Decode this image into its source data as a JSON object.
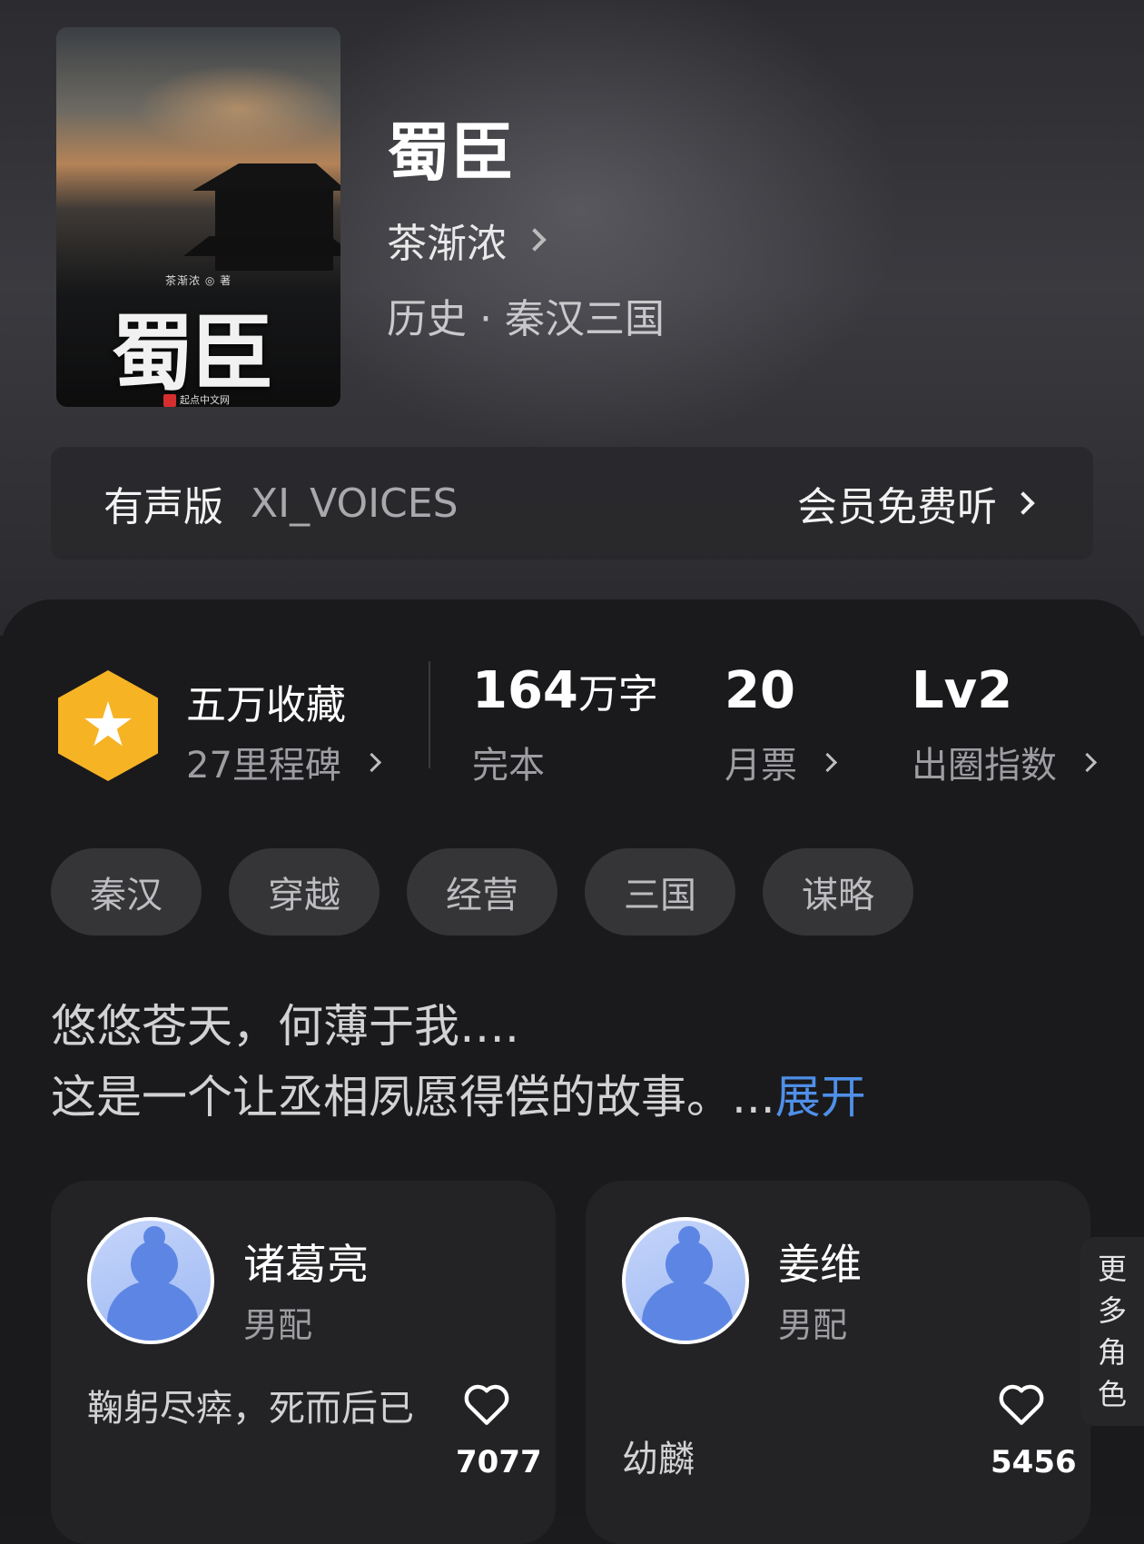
{
  "book": {
    "cover_title": "蜀臣",
    "cover_author": "茶渐浓 ◎ 著",
    "cover_publisher": "起点中文网",
    "title": "蜀臣",
    "author": "茶渐浓",
    "category": "历史 · 秦汉三国"
  },
  "audio": {
    "label": "有声版",
    "voice": "XI_VOICES",
    "cta": "会员免费听"
  },
  "stats": {
    "collection_main": "五万收藏",
    "collection_sub": "27里程碑",
    "words_num": "164",
    "words_unit": "万字",
    "words_sub": "完本",
    "monthly_votes": "20",
    "monthly_votes_sub": "月票",
    "level": "Lv2",
    "level_sub": "出圈指数"
  },
  "tags": [
    "秦汉",
    "穿越",
    "经营",
    "三国",
    "谋略"
  ],
  "synopsis": {
    "line1": "悠悠苍天，何薄于我….",
    "line2": "这是一个让丞相夙愿得偿的故事。...",
    "expand": "展开"
  },
  "characters": [
    {
      "name": "诸葛亮",
      "role": "男配",
      "quote": "鞠躬尽瘁，死而后已",
      "likes": "7077"
    },
    {
      "name": "姜维",
      "role": "男配",
      "quote": "幼麟",
      "likes": "5456"
    }
  ],
  "more_roles": [
    "更",
    "多",
    "角",
    "色"
  ],
  "colors": {
    "accent": "#4f8fe8",
    "badge": "#f6b324",
    "background": "#1a1a1c"
  }
}
